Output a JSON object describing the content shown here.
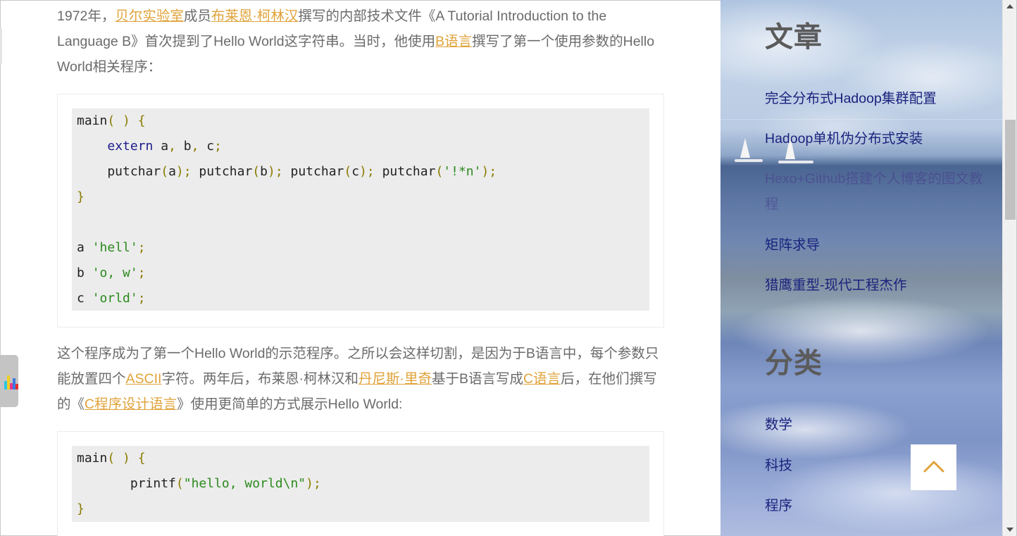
{
  "article": {
    "para1": {
      "t1": "1972年，",
      "link1": "贝尔实验室",
      "t2": "成员",
      "link2": "布莱恩·柯林汉",
      "t3": "撰写的内部技术文件《A Tutorial Introduction to the Language B》首次提到了Hello World这字符串。当时，他使用",
      "link3": "B语言",
      "t4": "撰写了第一个使用参数的Hello World相关程序："
    },
    "code1": [
      [
        {
          "c": "plain",
          "t": "main"
        },
        {
          "c": "punc",
          "t": "( ) {"
        }
      ],
      [
        {
          "c": "plain",
          "t": "    "
        },
        {
          "c": "kw",
          "t": "extern"
        },
        {
          "c": "plain",
          "t": " a"
        },
        {
          "c": "punc",
          "t": ","
        },
        {
          "c": "plain",
          "t": " b"
        },
        {
          "c": "punc",
          "t": ","
        },
        {
          "c": "plain",
          "t": " c"
        },
        {
          "c": "punc",
          "t": ";"
        }
      ],
      [
        {
          "c": "plain",
          "t": "    putchar"
        },
        {
          "c": "punc",
          "t": "("
        },
        {
          "c": "plain",
          "t": "a"
        },
        {
          "c": "punc",
          "t": ");"
        },
        {
          "c": "plain",
          "t": " putchar"
        },
        {
          "c": "punc",
          "t": "("
        },
        {
          "c": "plain",
          "t": "b"
        },
        {
          "c": "punc",
          "t": ");"
        },
        {
          "c": "plain",
          "t": " putchar"
        },
        {
          "c": "punc",
          "t": "("
        },
        {
          "c": "plain",
          "t": "c"
        },
        {
          "c": "punc",
          "t": ");"
        },
        {
          "c": "plain",
          "t": " putchar"
        },
        {
          "c": "punc",
          "t": "("
        },
        {
          "c": "str",
          "t": "'!*n'"
        },
        {
          "c": "punc",
          "t": ");"
        }
      ],
      [
        {
          "c": "punc",
          "t": "}"
        }
      ],
      [],
      [
        {
          "c": "plain",
          "t": "a "
        },
        {
          "c": "str",
          "t": "'hell'"
        },
        {
          "c": "punc",
          "t": ";"
        }
      ],
      [
        {
          "c": "plain",
          "t": "b "
        },
        {
          "c": "str",
          "t": "'o, w'"
        },
        {
          "c": "punc",
          "t": ";"
        }
      ],
      [
        {
          "c": "plain",
          "t": "c "
        },
        {
          "c": "str",
          "t": "'orld'"
        },
        {
          "c": "punc",
          "t": ";"
        }
      ]
    ],
    "para2": {
      "t1": "这个程序成为了第一个Hello World的示范程序。之所以会这样切割，是因为于B语言中，每个参数只能放置四个",
      "link1": "ASCII",
      "t2": "字符。两年后，布莱恩·柯林汉和",
      "link2": "丹尼斯·里奇",
      "t3": "基于B语言写成",
      "link3": "C语言",
      "t4": "后，在他们撰写的《",
      "link4": "C程序设计语言",
      "t5": "》使用更简单的方式展示Hello World:"
    },
    "code2": [
      [
        {
          "c": "plain",
          "t": "main"
        },
        {
          "c": "punc",
          "t": "( ) {"
        }
      ],
      [
        {
          "c": "plain",
          "t": "       printf"
        },
        {
          "c": "punc",
          "t": "("
        },
        {
          "c": "str",
          "t": "\"hello, world\\n\""
        },
        {
          "c": "punc",
          "t": ");"
        }
      ],
      [
        {
          "c": "punc",
          "t": "}"
        }
      ]
    ]
  },
  "sidebar": {
    "articles_heading": "文章",
    "articles": [
      "完全分布式Hadoop集群配置",
      "Hadoop单机伪分布式安装",
      "Hexo+Github搭建个人博客的图文教程",
      "矩阵求导",
      "猎鹰重型-现代工程杰作"
    ],
    "categories_heading": "分类",
    "categories": [
      "数学",
      "科技",
      "程序"
    ]
  },
  "icons": {
    "back_to_top": "chevron-up-icon",
    "stats_widget": "bar-chart-icon"
  },
  "colors": {
    "link": "#e0a33a",
    "sidebar_link": "#1a237e",
    "body_text": "#6b6b6b",
    "code_bg": "#ececec"
  }
}
